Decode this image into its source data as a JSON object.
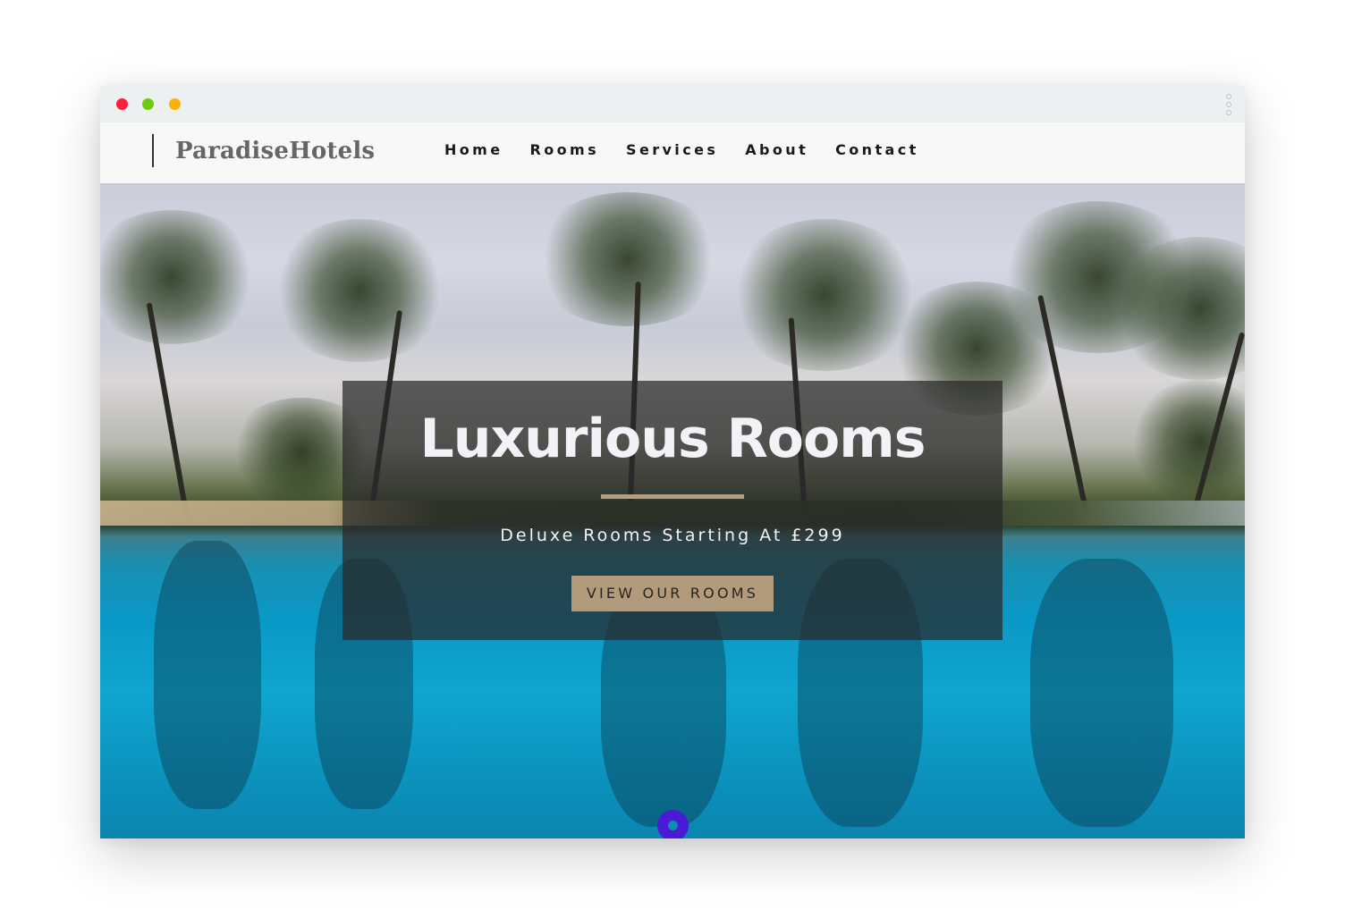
{
  "window": {
    "controls": [
      "close",
      "minimize",
      "maximize"
    ],
    "menu_icon": "kebab-icon"
  },
  "navbar": {
    "brand": "ParadiseHotels",
    "items": [
      {
        "label": "Home"
      },
      {
        "label": "Rooms"
      },
      {
        "label": "Services"
      },
      {
        "label": "About"
      },
      {
        "label": "Contact"
      }
    ]
  },
  "hero": {
    "title": "Luxurious Rooms",
    "subtitle": "Deluxe Rooms Starting At £299",
    "cta_label": "VIEW OUR ROOMS",
    "background": "tropical pool with palm trees",
    "scroll_indicator": "scroll-down-icon"
  },
  "colors": {
    "accent": "#b19b7c",
    "close": "#ff1f3a",
    "minimize": "#6ccb0b",
    "maximize": "#ffb10a",
    "scroll_dot": "#4a1ad6"
  }
}
